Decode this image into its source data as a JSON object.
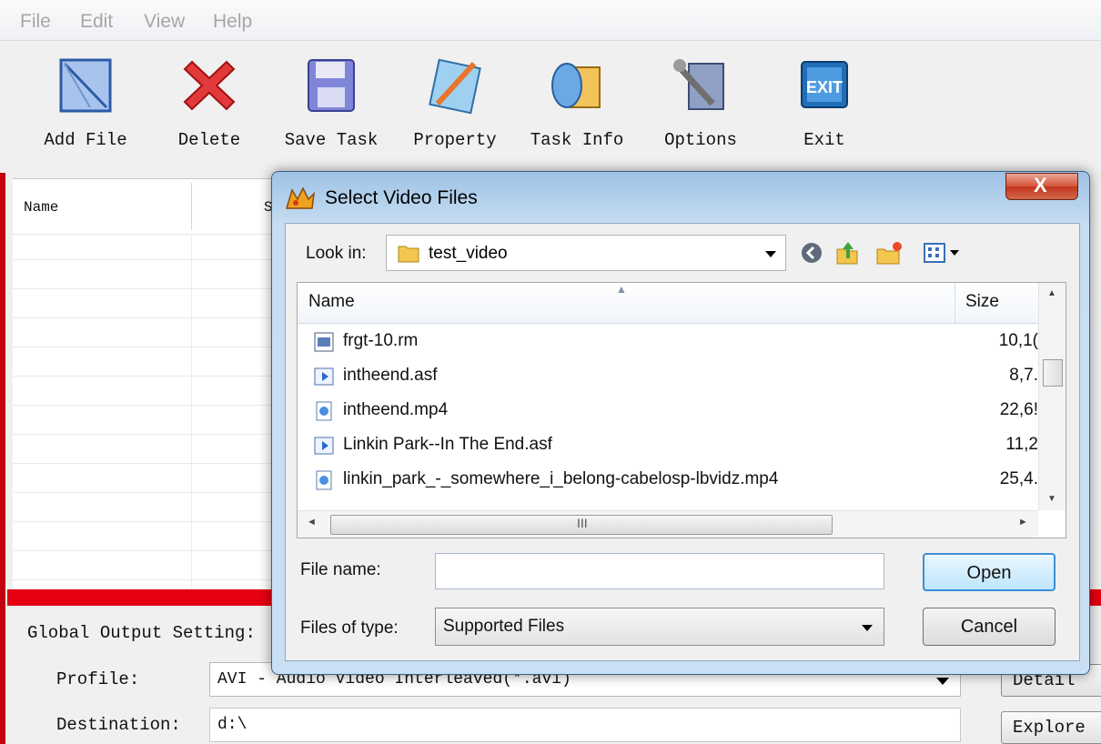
{
  "menu": [
    "File",
    "Edit",
    "View",
    "Help"
  ],
  "toolbar": [
    {
      "label": "Add File",
      "icon": "add-file-icon"
    },
    {
      "label": "Delete",
      "icon": "delete-icon"
    },
    {
      "label": "Save Task",
      "icon": "floppy-disk-icon"
    },
    {
      "label": "Property",
      "icon": "property-icon"
    },
    {
      "label": "Task Info",
      "icon": "task-info-icon"
    },
    {
      "label": "Options",
      "icon": "options-icon"
    },
    {
      "label": "Exit",
      "icon": "exit-icon"
    }
  ],
  "task_list": {
    "columns": [
      "Name",
      "S"
    ]
  },
  "settings": {
    "global_label": "Global Output Setting:",
    "profile_label": "Profile:",
    "profile_value": "AVI - Audio Video Interleaved(*.avi)",
    "destination_label": "Destination:",
    "destination_value": "d:\\",
    "detail_button": "Detail",
    "explore_button": "Explore"
  },
  "dialog": {
    "title": "Select Video Files",
    "look_in_label": "Look in:",
    "look_in_value": "test_video",
    "columns": {
      "name": "Name",
      "size": "Size"
    },
    "files": [
      {
        "name": "frgt-10.rm",
        "size": "10,1(",
        "icon": "realmedia-file-icon"
      },
      {
        "name": "intheend.asf",
        "size": "8,7.",
        "icon": "media-file-icon"
      },
      {
        "name": "intheend.mp4",
        "size": "22,6!",
        "icon": "mp4-file-icon"
      },
      {
        "name": "Linkin Park--In The End.asf",
        "size": "11,2",
        "icon": "media-file-icon"
      },
      {
        "name": "linkin_park_-_somewhere_i_belong-cabelosp-lbvidz.mp4",
        "size": "25,4.",
        "icon": "mp4-file-icon"
      }
    ],
    "hscroll_grip": "III",
    "file_name_label": "File name:",
    "file_name_value": "",
    "files_of_type_label": "Files of type:",
    "files_of_type_value": "Supported Files",
    "open_button": "Open",
    "cancel_button": "Cancel",
    "close_glyph": "X"
  },
  "colors": {
    "accent_red": "#e60012",
    "dialog_frame": "#c9dff3",
    "open_focus": "#3c8fd6"
  }
}
